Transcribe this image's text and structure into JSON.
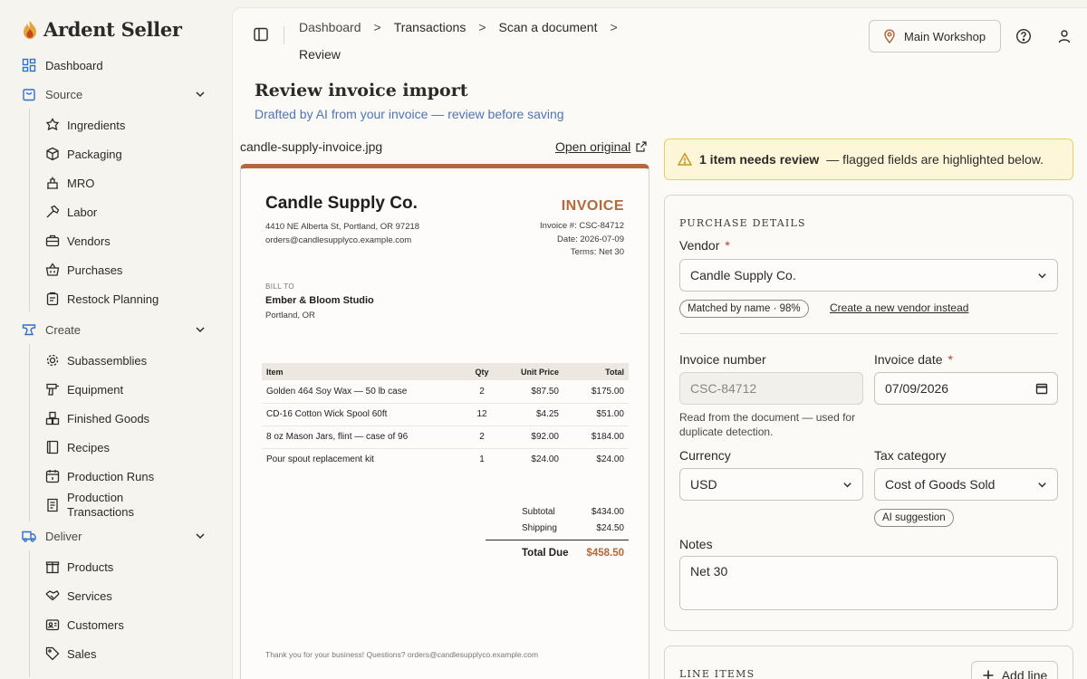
{
  "brand": {
    "name": "Ardent Seller"
  },
  "nav": {
    "dashboard": "Dashboard",
    "source": {
      "label": "Source",
      "items": [
        "Ingredients",
        "Packaging",
        "MRO",
        "Labor",
        "Vendors",
        "Purchases",
        "Restock Planning"
      ]
    },
    "create": {
      "label": "Create",
      "items": [
        "Subassemblies",
        "Equipment",
        "Finished Goods",
        "Recipes",
        "Production Runs"
      ],
      "production_transactions_l1": "Production",
      "production_transactions_l2": "Transactions"
    },
    "deliver": {
      "label": "Deliver",
      "items": [
        "Products",
        "Services",
        "Customers",
        "Sales"
      ]
    }
  },
  "breadcrumb": {
    "items": [
      "Dashboard",
      "Transactions",
      "Scan a document"
    ],
    "current": "Review",
    "sep": ">"
  },
  "topbar": {
    "workshop": "Main Workshop"
  },
  "page": {
    "title": "Review invoice import",
    "subtitle": "Drafted by AI from your invoice — review before saving"
  },
  "document": {
    "filename": "candle-supply-invoice.jpg",
    "open_original": "Open original",
    "invoice": {
      "company": "Candle Supply Co.",
      "address": "4410 NE Alberta St, Portland, OR 97218",
      "email": "orders@candlesupplyco.example.com",
      "title": "INVOICE",
      "number": "Invoice #: CSC-84712",
      "date": "Date: 2026-07-09",
      "terms": "Terms: Net 30",
      "bill_to_label": "BILL TO",
      "bill_to_name": "Ember & Bloom Studio",
      "bill_to_city": "Portland, OR",
      "columns": [
        "Item",
        "Qty",
        "Unit Price",
        "Total"
      ],
      "rows": [
        [
          "Golden 464 Soy Wax — 50 lb case",
          "2",
          "$87.50",
          "$175.00"
        ],
        [
          "CD-16 Cotton Wick Spool 60ft",
          "12",
          "$4.25",
          "$51.00"
        ],
        [
          "8 oz Mason Jars, flint — case of 96",
          "2",
          "$92.00",
          "$184.00"
        ],
        [
          "Pour spout replacement kit",
          "1",
          "$24.00",
          "$24.00"
        ]
      ],
      "subtotal_label": "Subtotal",
      "subtotal": "$434.00",
      "shipping_label": "Shipping",
      "shipping": "$24.50",
      "total_label": "Total Due",
      "total": "$458.50",
      "footer": "Thank you for your business! Questions? orders@candlesupplyco.example.com"
    }
  },
  "alert": {
    "strong": "1 item needs review",
    "rest": "— flagged fields are highlighted below."
  },
  "purchase": {
    "heading": "PURCHASE DETAILS",
    "vendor_label": "Vendor",
    "vendor_value": "Candle Supply Co.",
    "match_pill": "Matched by name · 98%",
    "create_vendor": "Create a new vendor instead",
    "invoice_number_label": "Invoice number",
    "invoice_number_value": "CSC-84712",
    "invoice_number_hint": "Read from the document — used for duplicate detection.",
    "invoice_date_label": "Invoice date",
    "invoice_date_value": "07/09/2026",
    "currency_label": "Currency",
    "currency_value": "USD",
    "tax_label": "Tax category",
    "tax_value": "Cost of Goods Sold",
    "ai_pill": "AI suggestion",
    "notes_label": "Notes",
    "notes_value": "Net 30",
    "required_mark": "*"
  },
  "line_items": {
    "heading": "LINE ITEMS",
    "add_line": "Add line"
  },
  "colors": {
    "accent": "#b5683a",
    "link_blue": "#4e74b8",
    "alert_bg": "#fdf6d9",
    "icon_blue": "#2d6fd6"
  }
}
